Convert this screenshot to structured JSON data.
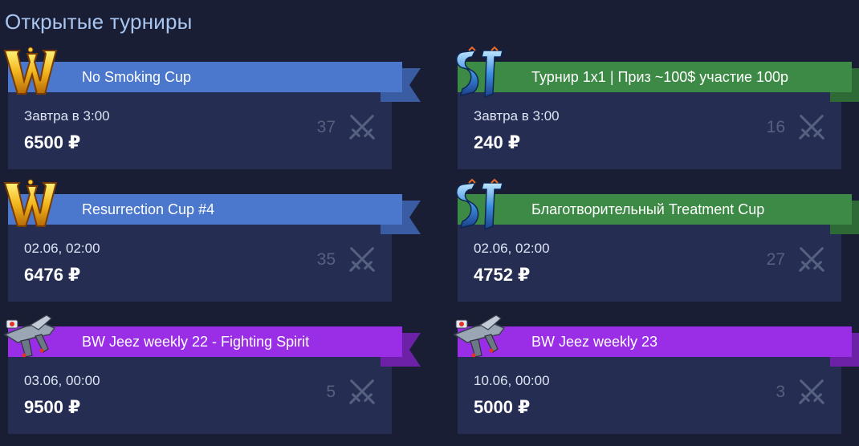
{
  "header": {
    "title": "Открытые турниры"
  },
  "colors": {
    "background": "#1a1e35",
    "card": "#252d52",
    "wow_banner": "#4b77cc",
    "sc2_banner": "#3d8a46",
    "bw_banner": "#9a2ee6",
    "title": "#a9c6f0"
  },
  "tournaments": [
    {
      "game_icon": "warcraft-logo-icon",
      "name": "No Smoking Cup",
      "date": "Завтра в 3:00",
      "prize": "6500 ₽",
      "participants": "37"
    },
    {
      "game_icon": "starcraft2-logo-icon",
      "name": "Турнир 1x1 | Приз ~100$ участие 100р",
      "date": "Завтра в 3:00",
      "prize": "240 ₽",
      "participants": "16"
    },
    {
      "game_icon": "warcraft-logo-icon",
      "name": "Resurrection Cup #4",
      "date": "02.06, 02:00",
      "prize": "6476 ₽",
      "participants": "35"
    },
    {
      "game_icon": "starcraft2-logo-icon",
      "name": "Благотворительный Treatment Cup",
      "date": "02.06, 02:00",
      "prize": "4752 ₽",
      "participants": "27"
    },
    {
      "game_icon": "broodwar-ship-icon",
      "name": "BW Jeez weekly 22 - Fighting Spirit",
      "date": "03.06, 00:00",
      "prize": "9500 ₽",
      "participants": "5"
    },
    {
      "game_icon": "broodwar-ship-icon",
      "name": "BW Jeez weekly 23",
      "date": "10.06, 00:00",
      "prize": "5000 ₽",
      "participants": "3"
    }
  ]
}
